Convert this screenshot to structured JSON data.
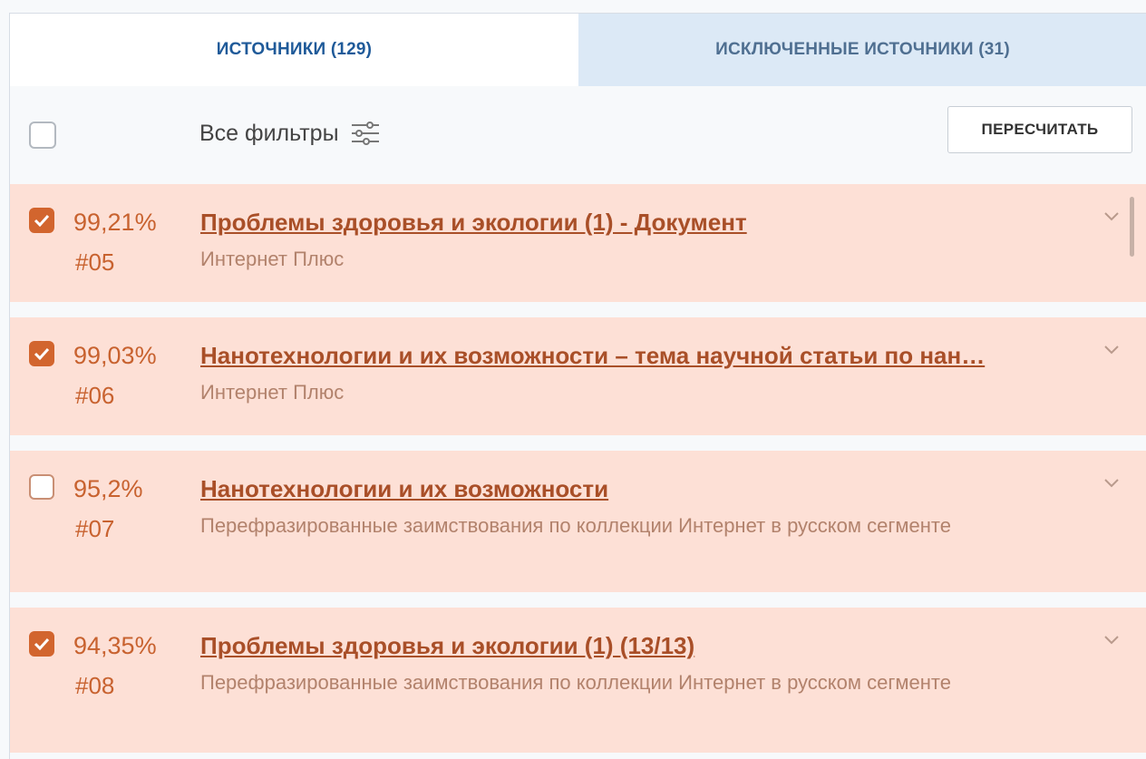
{
  "tabs": {
    "sources": "ИСТОЧНИКИ (129)",
    "excluded": "ИСКЛЮЧЕННЫЕ ИСТОЧНИКИ (31)"
  },
  "toolbar": {
    "filters_label": "Все фильтры",
    "filters_icon": "sliders-icon",
    "recalc_label": "ПЕРЕСЧИТАТЬ"
  },
  "sources": [
    {
      "checked": true,
      "percent": "99,21%",
      "number": "#05",
      "title": "Проблемы здоровья и экологии (1) - Документ",
      "subtitle": "Интернет Плюс"
    },
    {
      "checked": true,
      "percent": "99,03%",
      "number": "#06",
      "title": "Нанотехнологии и их возможности – тема научной статьи по нан…",
      "subtitle": "Интернет Плюс"
    },
    {
      "checked": false,
      "percent": "95,2%",
      "number": "#07",
      "title": "Нанотехнологии и их возможности",
      "subtitle": "Перефразированные заимствования по коллекции Интернет в русском сегменте"
    },
    {
      "checked": true,
      "percent": "94,35%",
      "number": "#08",
      "title": "Проблемы здоровья и экологии (1) (13/13)",
      "subtitle": "Перефразированные заимствования по коллекции Интернет в русском сегменте"
    }
  ],
  "colors": {
    "accent": "#d2652e",
    "row_bg": "#fde0d6",
    "tab_active": "#1f5a99",
    "tab_inactive_bg": "#dce9f6"
  }
}
